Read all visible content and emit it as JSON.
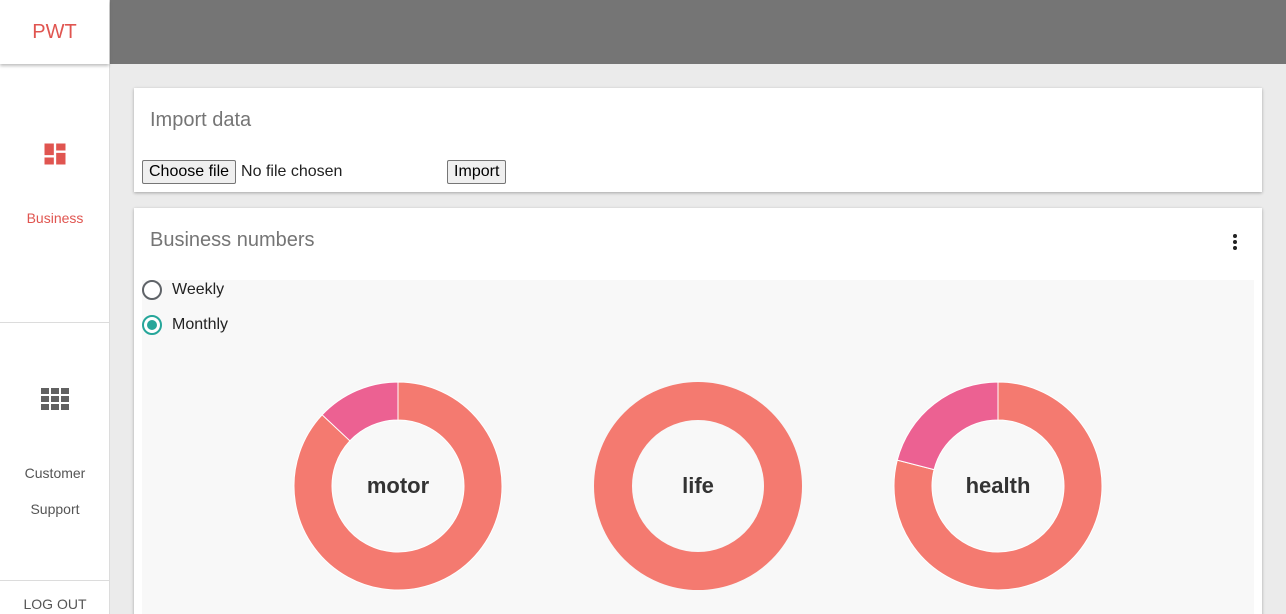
{
  "app": {
    "brand": "PWT"
  },
  "sidebar": {
    "items": [
      {
        "label": "Business",
        "icon": "dashboard-icon",
        "active": true
      },
      {
        "label_lines": [
          "Customer",
          "Support"
        ],
        "icon": "apps-grid-icon",
        "active": false
      }
    ],
    "logout": "LOG OUT"
  },
  "import": {
    "title": "Import data",
    "choose_label": "Choose file",
    "file_status": "No file chosen",
    "import_label": "Import"
  },
  "business": {
    "title": "Business numbers",
    "menu_icon": "more-vert-icon",
    "periods": [
      {
        "label": "Weekly",
        "selected": false
      },
      {
        "label": "Monthly",
        "selected": true
      }
    ]
  },
  "colors": {
    "accent": "#e05550",
    "primary_slice": "#f47a70",
    "secondary_slice": "#ec6192",
    "radio_selected": "#26a69a",
    "topbar": "#757575"
  },
  "chart_data": [
    {
      "type": "pie",
      "title": "motor",
      "values": [
        87,
        13
      ]
    },
    {
      "type": "pie",
      "title": "life",
      "values": [
        100,
        0
      ]
    },
    {
      "type": "pie",
      "title": "health",
      "values": [
        79,
        21
      ]
    }
  ]
}
